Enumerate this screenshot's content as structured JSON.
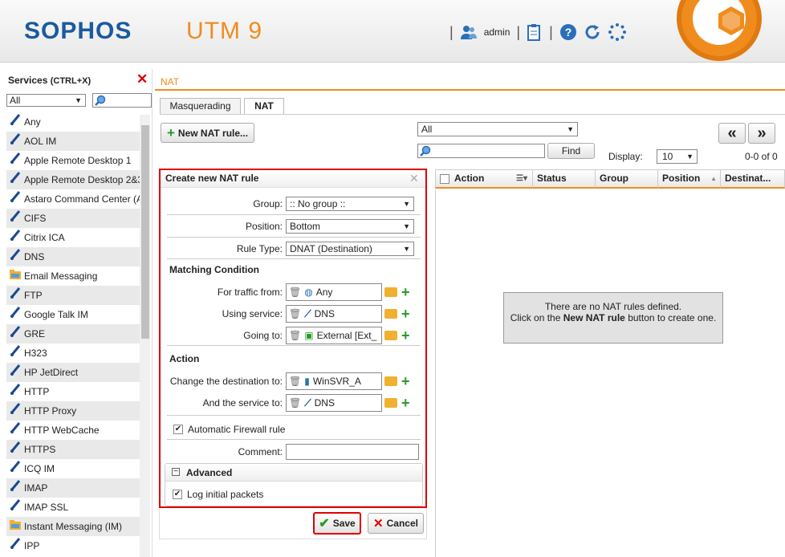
{
  "header": {
    "brand": "SOPHOS",
    "product": "UTM 9",
    "user": "admin",
    "icons": [
      "user-icon",
      "clipboard-icon",
      "help-icon",
      "refresh-icon",
      "spinner-icon"
    ]
  },
  "services_panel": {
    "title": "Services",
    "shortcut": "(CTRL+X)",
    "filter_value": "All",
    "items": [
      {
        "label": "Any",
        "icon": "service-icon"
      },
      {
        "label": "AOL IM",
        "icon": "service-icon"
      },
      {
        "label": "Apple Remote Desktop 1",
        "icon": "service-icon"
      },
      {
        "label": "Apple Remote Desktop 2&3",
        "icon": "service-icon"
      },
      {
        "label": "Astaro Command Center (A",
        "icon": "service-icon"
      },
      {
        "label": "CIFS",
        "icon": "service-icon"
      },
      {
        "label": "Citrix ICA",
        "icon": "service-icon"
      },
      {
        "label": "DNS",
        "icon": "service-icon"
      },
      {
        "label": "Email Messaging",
        "icon": "group-icon"
      },
      {
        "label": "FTP",
        "icon": "service-icon"
      },
      {
        "label": "Google Talk IM",
        "icon": "service-icon"
      },
      {
        "label": "GRE",
        "icon": "service-icon"
      },
      {
        "label": "H323",
        "icon": "service-icon"
      },
      {
        "label": "HP JetDirect",
        "icon": "service-icon"
      },
      {
        "label": "HTTP",
        "icon": "service-icon"
      },
      {
        "label": "HTTP Proxy",
        "icon": "service-icon"
      },
      {
        "label": "HTTP WebCache",
        "icon": "service-icon"
      },
      {
        "label": "HTTPS",
        "icon": "service-icon"
      },
      {
        "label": "ICQ IM",
        "icon": "service-icon"
      },
      {
        "label": "IMAP",
        "icon": "service-icon"
      },
      {
        "label": "IMAP SSL",
        "icon": "service-icon"
      },
      {
        "label": "Instant Messaging (IM)",
        "icon": "group-icon"
      },
      {
        "label": "IPP",
        "icon": "service-icon"
      }
    ]
  },
  "main": {
    "breadcrumb": "NAT",
    "tabs": [
      {
        "label": "Masquerading"
      },
      {
        "label": "NAT"
      }
    ],
    "new_rule_button": "New NAT rule...",
    "filter_value": "All",
    "find_button": "Find",
    "prev_label": "«",
    "next_label": "»",
    "display_label": "Display:",
    "display_value": "10",
    "pager_count": "0-0 of 0",
    "grid_columns": [
      "Action",
      "Status",
      "Group",
      "Position",
      "Destinat..."
    ],
    "empty_message_1": "There are no NAT rules defined.",
    "empty_message_2a": "Click on the ",
    "empty_message_2b": "New NAT rule",
    "empty_message_2c": " button to create one."
  },
  "form": {
    "title": "Create new NAT rule",
    "group_label": "Group:",
    "group_value": ":: No group ::",
    "position_label": "Position:",
    "position_value": "Bottom",
    "rule_type_label": "Rule Type:",
    "rule_type_value": "DNAT (Destination)",
    "matching_heading": "Matching Condition",
    "traffic_from_label": "For traffic from:",
    "traffic_from_value": "Any",
    "using_service_label": "Using service:",
    "using_service_value": "DNS",
    "going_to_label": "Going to:",
    "going_to_value": "External [Ext_",
    "action_heading": "Action",
    "change_dest_label": "Change the destination to:",
    "change_dest_value": "WinSVR_A",
    "service_to_label": "And the service to:",
    "service_to_value": "DNS",
    "auto_firewall_label": "Automatic Firewall rule",
    "auto_firewall_checked": true,
    "comment_label": "Comment:",
    "comment_value": "",
    "advanced_heading": "Advanced",
    "log_packets_label": "Log initial packets",
    "log_packets_checked": true,
    "save_button": "Save",
    "cancel_button": "Cancel"
  },
  "colors": {
    "accent": "#f08c1e",
    "brand": "#1a5aa0",
    "highlight": "#e00000",
    "add": "#2a9a2a"
  }
}
